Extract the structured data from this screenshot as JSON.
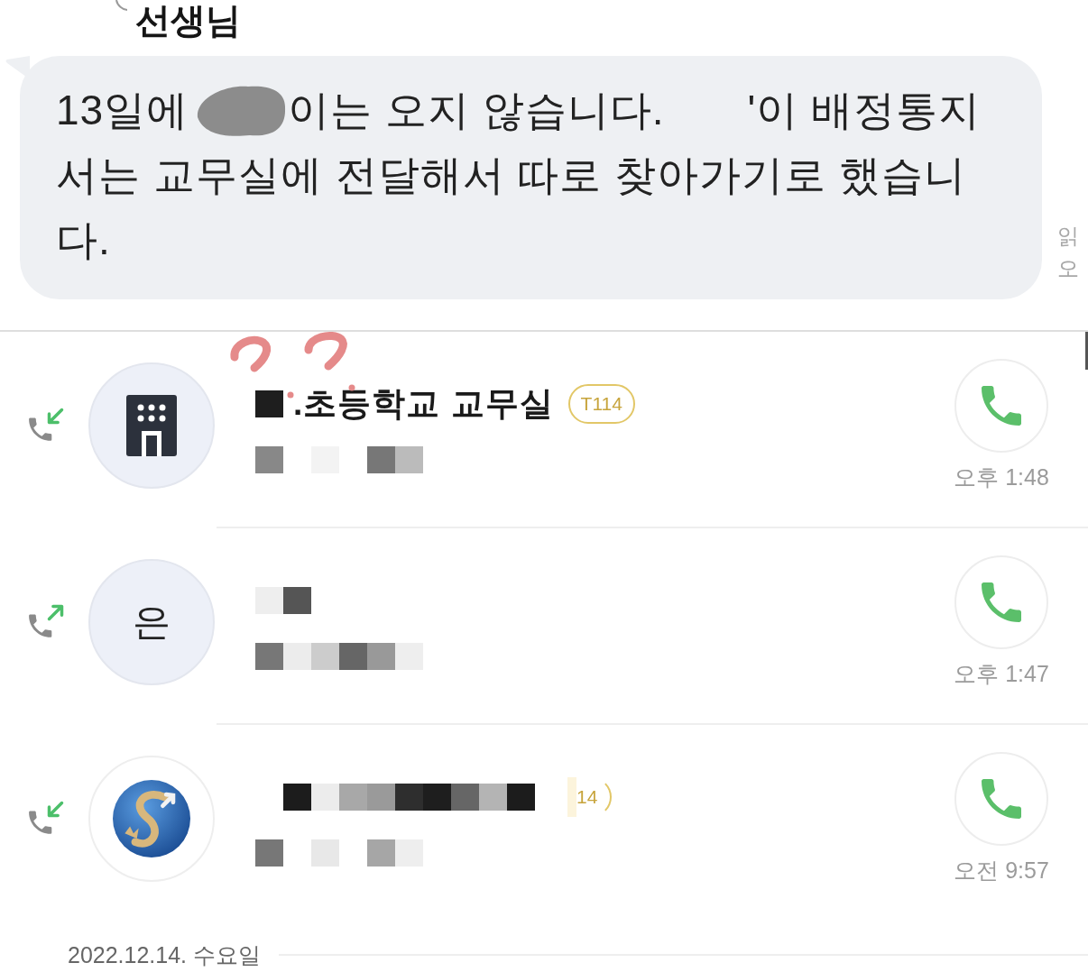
{
  "chat": {
    "sender": "선생님",
    "message": {
      "lines": [
        {
          "parts": [
            {
              "kind": "text",
              "text": "13일에"
            },
            {
              "kind": "redacted"
            },
            {
              "kind": "text",
              "text": "이는 오지 않습니다."
            },
            {
              "kind": "gap"
            },
            {
              "kind": "text",
              "text": "'이 배정통지"
            }
          ]
        },
        {
          "parts": [
            {
              "kind": "text",
              "text": "서는 교무실에 전달해서 따로 찾아가기로 했습니"
            }
          ]
        },
        {
          "parts": [
            {
              "kind": "text",
              "text": "다."
            }
          ]
        }
      ]
    },
    "read_status": "읽",
    "time": "오"
  },
  "calls": [
    {
      "kind": "incoming",
      "avatar": {
        "kind": "building"
      },
      "title": [
        {
          "kind": "pixels",
          "cells": [
            {
              "kind": "pixel",
              "color": "#1e1e1e"
            }
          ]
        },
        {
          "kind": "text",
          "text": ".초등학교 교무실"
        },
        {
          "kind": "badge",
          "text": "T114"
        }
      ],
      "subtitle": {
        "cells": [
          {
            "kind": "pixel",
            "color": "#888888"
          },
          {
            "kind": "blank"
          },
          {
            "kind": "pixel",
            "color": "#f3f3f3"
          },
          {
            "kind": "blank"
          },
          {
            "kind": "pixel",
            "color": "#777777"
          },
          {
            "kind": "pixel",
            "color": "#bbbbbb"
          }
        ]
      },
      "time": "오후 1:48"
    },
    {
      "kind": "outgoing",
      "avatar": {
        "kind": "letter",
        "text": "은"
      },
      "title": [
        {
          "kind": "pixels",
          "cells": [
            {
              "kind": "pixel",
              "color": "#eeeeee"
            },
            {
              "kind": "pixel",
              "color": "#555555"
            }
          ]
        }
      ],
      "subtitle": {
        "cells": [
          {
            "kind": "pixel",
            "color": "#777777"
          },
          {
            "kind": "pixel",
            "color": "#ececec"
          },
          {
            "kind": "pixel",
            "color": "#cccccc"
          },
          {
            "kind": "pixel",
            "color": "#666666"
          },
          {
            "kind": "pixel",
            "color": "#999999"
          },
          {
            "kind": "pixel",
            "color": "#eeeeee"
          }
        ]
      },
      "time": "오후 1:47"
    },
    {
      "kind": "incoming",
      "avatar": {
        "kind": "logo"
      },
      "title": [
        {
          "kind": "pixels",
          "cells": [
            {
              "kind": "blank"
            },
            {
              "kind": "pixel",
              "color": "#1c1c1c"
            },
            {
              "kind": "pixel",
              "color": "#ececec"
            },
            {
              "kind": "pixel",
              "color": "#a8a8a8"
            },
            {
              "kind": "pixel",
              "color": "#9a9a9a"
            },
            {
              "kind": "pixel",
              "color": "#2e2e2e"
            },
            {
              "kind": "pixel",
              "color": "#1e1e1e"
            },
            {
              "kind": "pixel",
              "color": "#666666"
            },
            {
              "kind": "pixel",
              "color": "#b4b4b4"
            },
            {
              "kind": "pixel",
              "color": "#1c1c1c"
            }
          ]
        },
        {
          "kind": "cut_badge",
          "text": "14"
        }
      ],
      "subtitle": {
        "cells": [
          {
            "kind": "pixel",
            "color": "#777777"
          },
          {
            "kind": "blank"
          },
          {
            "kind": "pixel",
            "color": "#e8e8e8"
          },
          {
            "kind": "blank"
          },
          {
            "kind": "pixel",
            "color": "#a6a6a6"
          },
          {
            "kind": "pixel",
            "color": "#eeeeee"
          }
        ]
      },
      "time": "오전 9:57"
    }
  ],
  "date": "2022.12.14. 수요일"
}
